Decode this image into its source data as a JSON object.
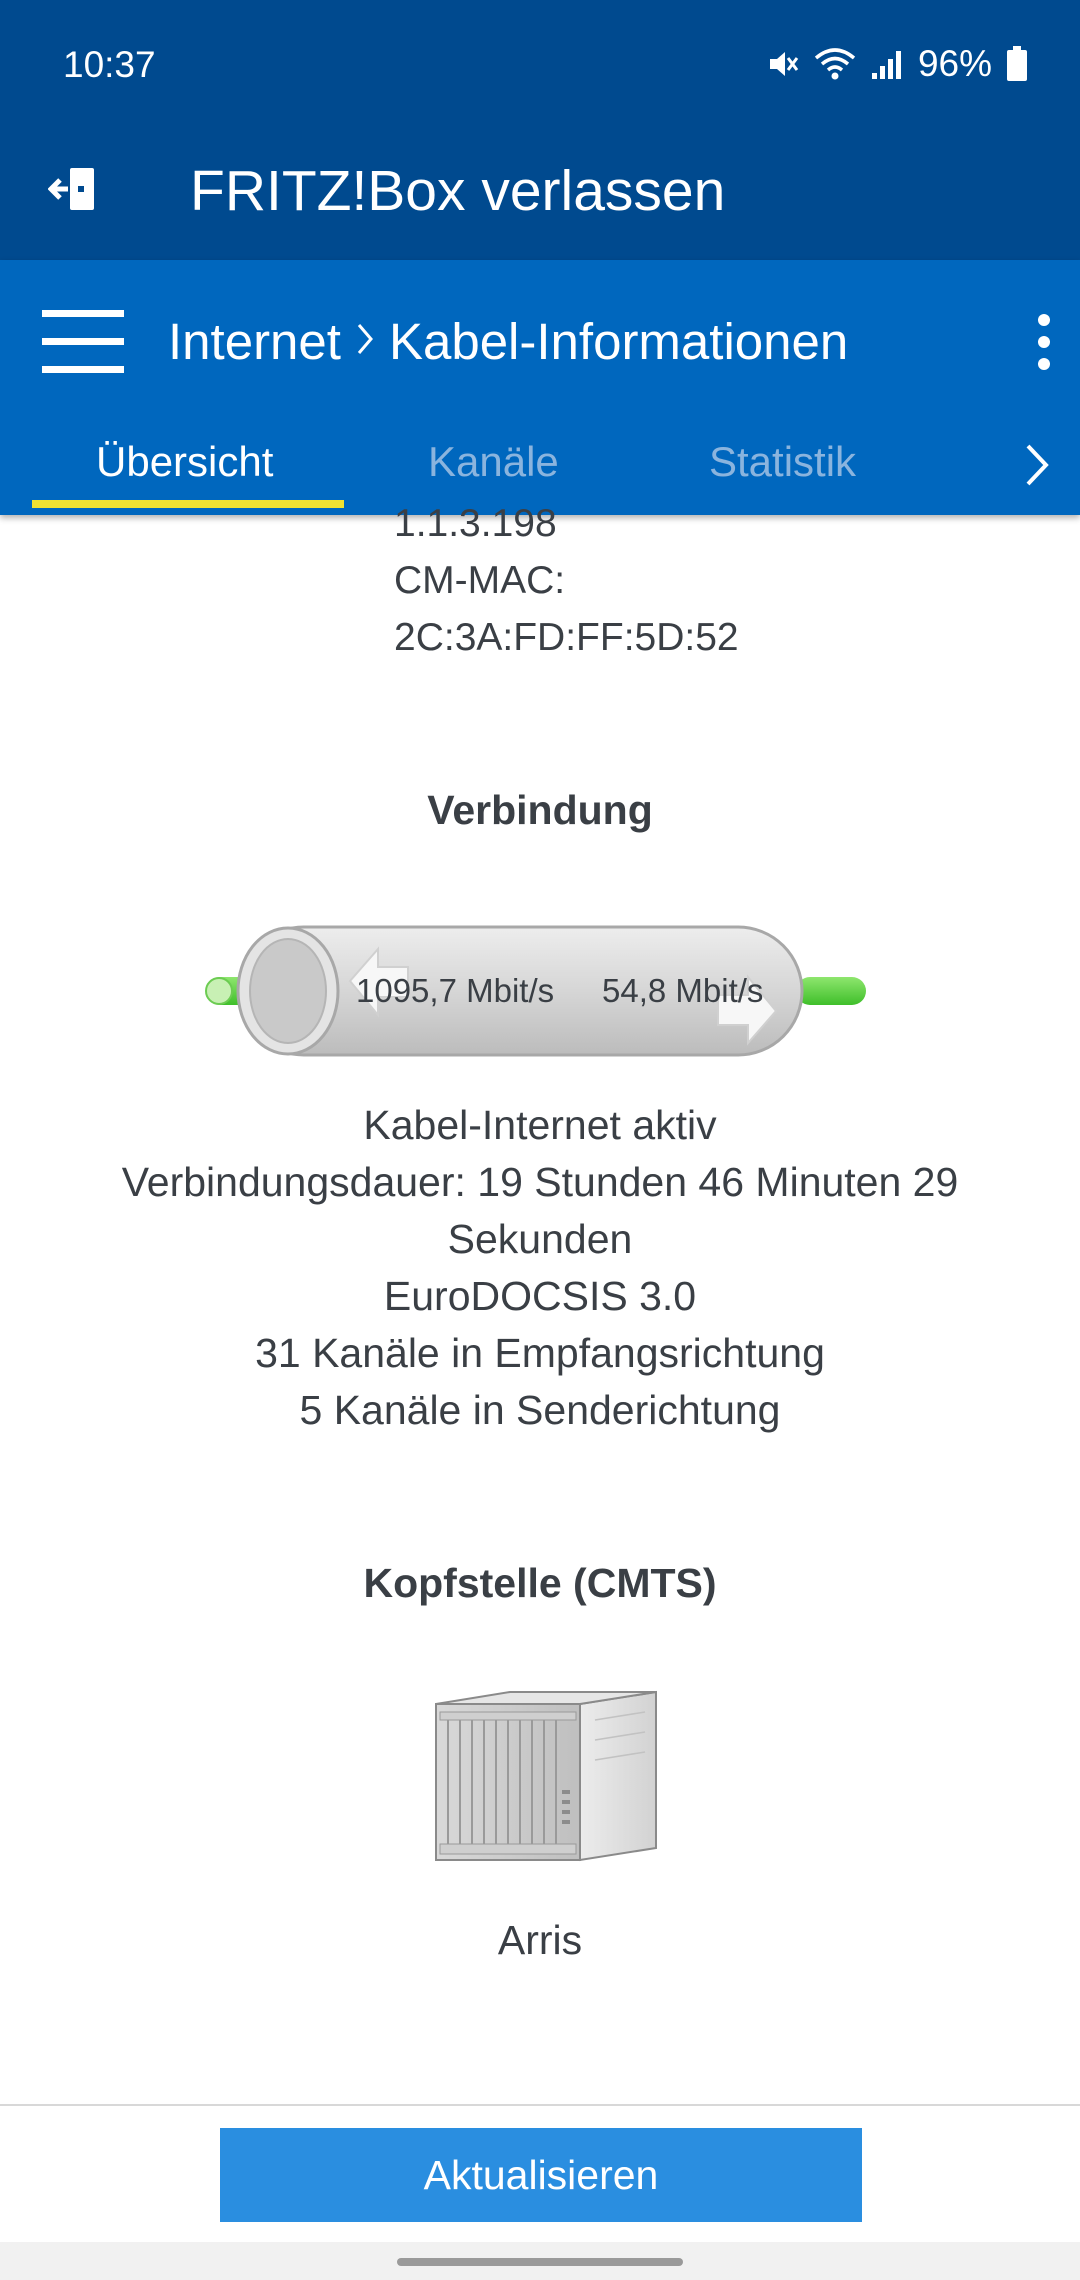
{
  "status_bar": {
    "time": "10:37",
    "battery": "96%",
    "icons": [
      "mute-icon",
      "wifi-icon",
      "signal-icon",
      "battery-icon"
    ]
  },
  "app_header": {
    "exit_icon": "exit-icon",
    "title": "FRITZ!Box verlassen"
  },
  "breadcrumb": {
    "section": "Internet",
    "page": "Kabel-Informationen"
  },
  "tabs": [
    {
      "label": "Übersicht",
      "active": true
    },
    {
      "label": "Kanäle",
      "active": false
    },
    {
      "label": "Statistik",
      "active": false
    }
  ],
  "modem_info": {
    "firmware_partial": "1.1.3.198",
    "cm_mac_label": "CM-MAC:",
    "cm_mac_value": "2C:3A:FD:FF:5D:52"
  },
  "connection": {
    "heading": "Verbindung",
    "downstream": "1095,7 Mbit/s",
    "upstream": "54,8 Mbit/s",
    "status": "Kabel-Internet aktiv",
    "duration_line1": "Verbindungsdauer: 19 Stunden 46 Minuten 29",
    "duration_line2": "Sekunden",
    "standard": "EuroDOCSIS 3.0",
    "downstream_channels": "31 Kanäle in Empfangsrichtung",
    "upstream_channels": "5 Kanäle in Senderichtung"
  },
  "cmts": {
    "heading": "Kopfstelle (CMTS)",
    "vendor": "Arris"
  },
  "actions": {
    "refresh_label": "Aktualisieren"
  },
  "colors": {
    "header_bg": "#004a8f",
    "breadcrumb_bg": "#0067be",
    "tab_indicator": "#f0e232",
    "button_bg": "#2a8ee0",
    "link_green": "#5fd24a"
  }
}
